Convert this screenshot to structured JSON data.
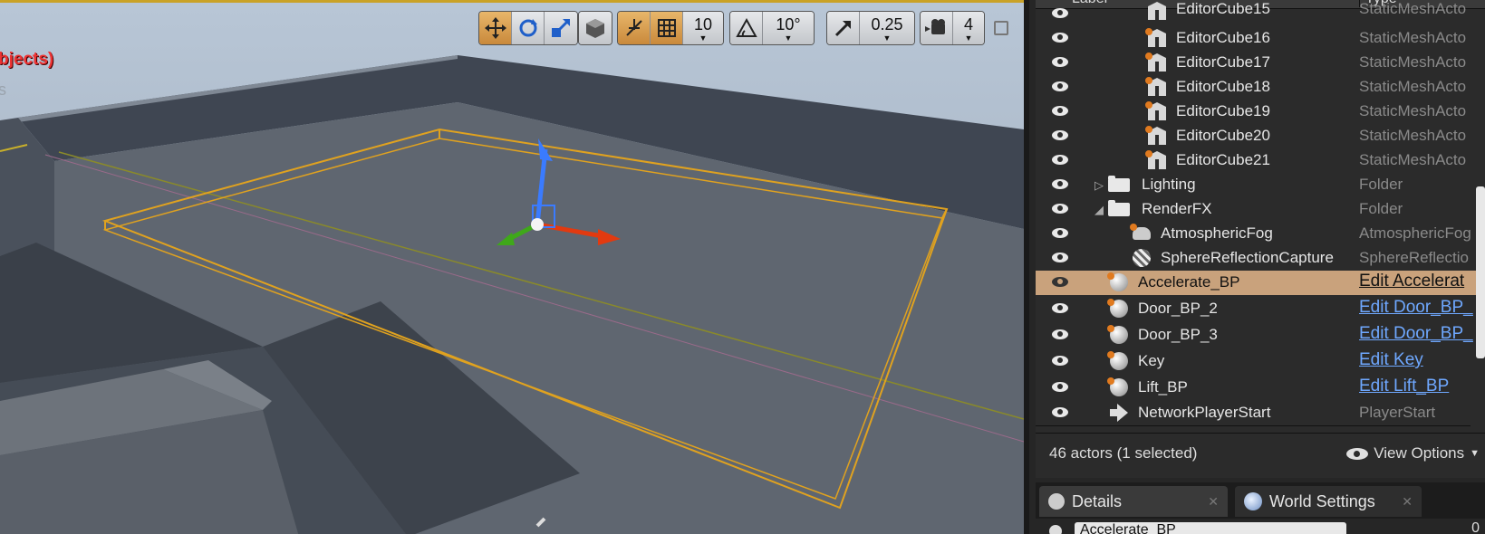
{
  "viewport": {
    "overlay_red": "bjects)",
    "overlay_grey": "s",
    "toolbar": {
      "grid_snap": "10",
      "rotation_snap": "10°",
      "scale_snap": "0.25",
      "camera_speed": "4"
    }
  },
  "outliner": {
    "header": {
      "label": "Label",
      "type": "Type"
    },
    "rows": [
      {
        "label": "EditorCube15",
        "type": "StaticMeshActo",
        "icon": "static-mesh-icon"
      },
      {
        "label": "EditorCube16",
        "type": "StaticMeshActo",
        "icon": "static-mesh-icon"
      },
      {
        "label": "EditorCube17",
        "type": "StaticMeshActo",
        "icon": "static-mesh-icon"
      },
      {
        "label": "EditorCube18",
        "type": "StaticMeshActo",
        "icon": "static-mesh-icon"
      },
      {
        "label": "EditorCube19",
        "type": "StaticMeshActo",
        "icon": "static-mesh-icon"
      },
      {
        "label": "EditorCube20",
        "type": "StaticMeshActo",
        "icon": "static-mesh-icon"
      },
      {
        "label": "EditorCube21",
        "type": "StaticMeshActo",
        "icon": "static-mesh-icon"
      },
      {
        "label": "Lighting",
        "type": "Folder",
        "icon": "folder-icon"
      },
      {
        "label": "RenderFX",
        "type": "Folder",
        "icon": "folder-open-icon"
      },
      {
        "label": "AtmosphericFog",
        "type": "AtmosphericFog",
        "icon": "fog-icon"
      },
      {
        "label": "SphereReflectionCapture",
        "type": "SphereReflectio",
        "icon": "sphere-reflection-icon"
      },
      {
        "label": "Accelerate_BP",
        "type": "Edit Accelerat",
        "icon": "blueprint-icon",
        "selected": true
      },
      {
        "label": "Door_BP_2",
        "type": "Edit Door_BP_",
        "icon": "blueprint-icon"
      },
      {
        "label": "Door_BP_3",
        "type": "Edit Door_BP_",
        "icon": "blueprint-icon"
      },
      {
        "label": "Key",
        "type": "Edit Key",
        "icon": "blueprint-icon"
      },
      {
        "label": "Lift_BP",
        "type": "Edit Lift_BP",
        "icon": "blueprint-icon"
      },
      {
        "label": "NetworkPlayerStart",
        "type": "PlayerStart",
        "icon": "player-start-icon"
      }
    ],
    "footer": {
      "count": "46 actors (1 selected)",
      "view_options": "View Options"
    }
  },
  "tabs": [
    {
      "label": "Details"
    },
    {
      "label": "World Settings"
    }
  ],
  "details": {
    "name_value": "Accelerate_BP",
    "right_value": "0"
  },
  "colors": {
    "selection": "#c9a27c",
    "link": "#6fa8ff",
    "bounds": "#e0a21f",
    "toolbar_active": "#d79b4e"
  }
}
